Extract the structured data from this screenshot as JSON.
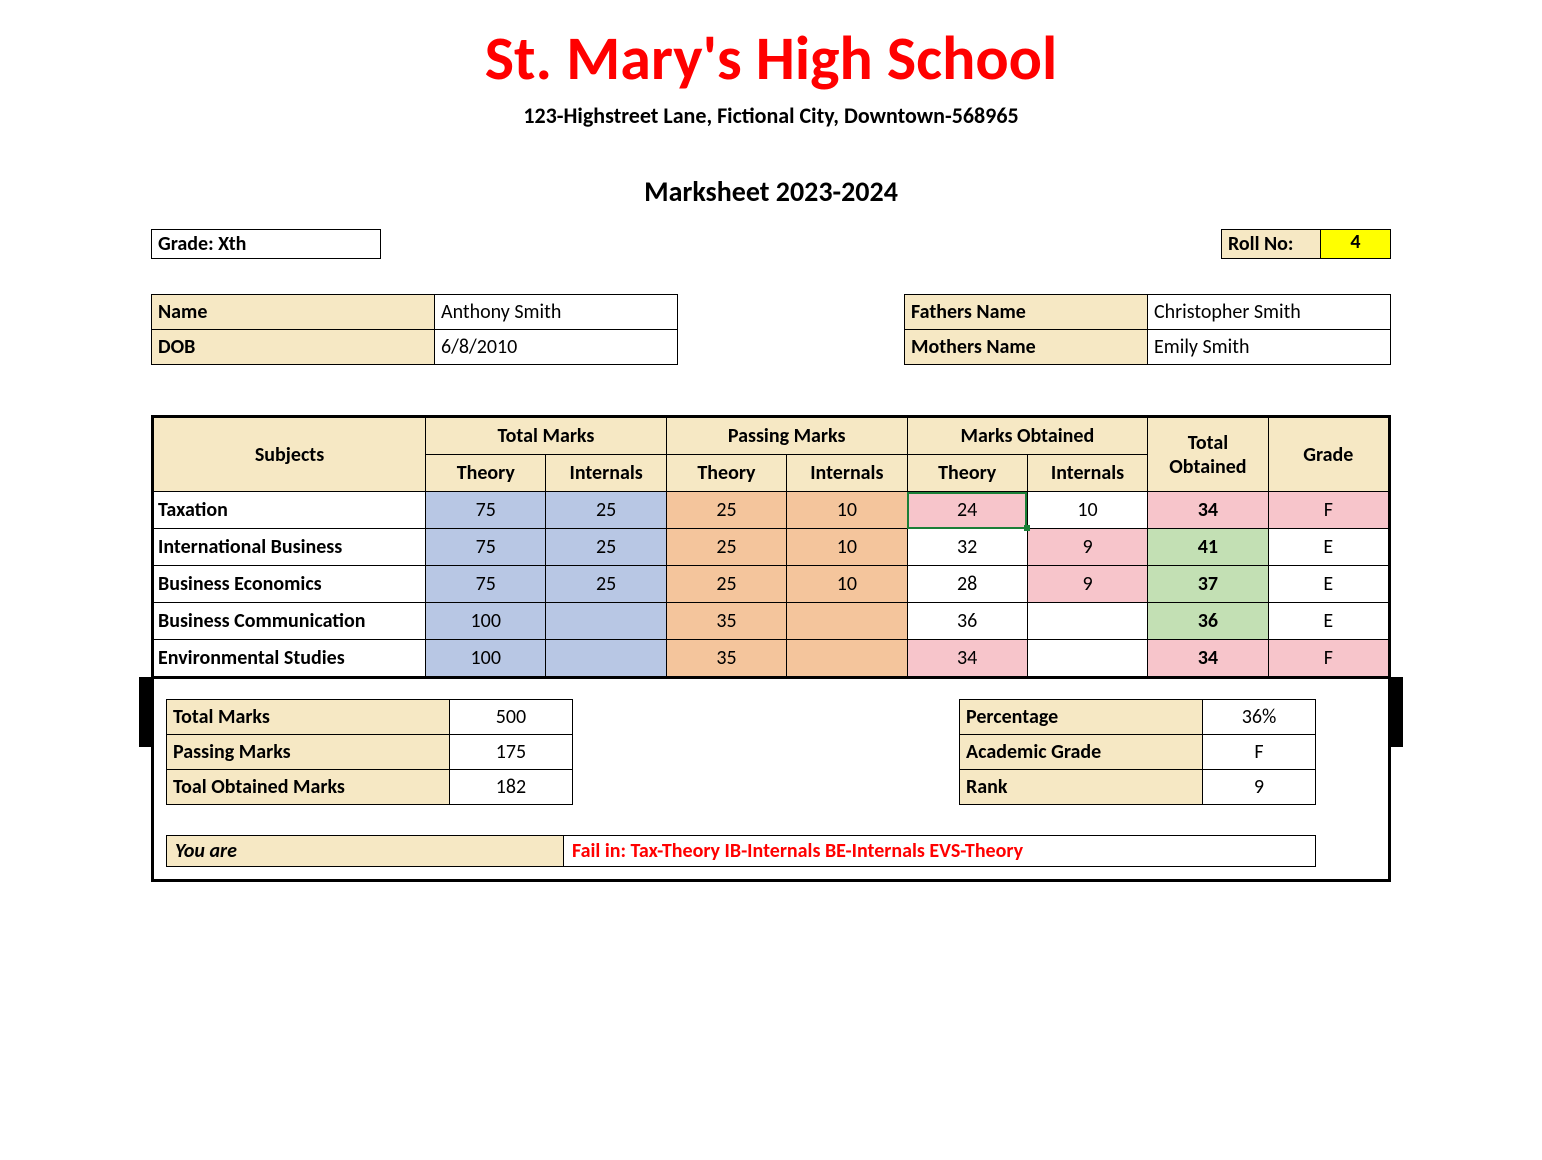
{
  "header": {
    "school_name": "St. Mary's High School",
    "address": "123-Highstreet Lane, Fictional City, Downtown-568965",
    "title": "Marksheet 2023-2024"
  },
  "grade": "Grade: Xth",
  "roll_label": "Roll No:",
  "roll_value": "4",
  "student": {
    "name_label": "Name",
    "name_value": "Anthony Smith",
    "dob_label": "DOB",
    "dob_value": "6/8/2010",
    "father_label": "Fathers Name",
    "father_value": "Christopher Smith",
    "mother_label": "Mothers Name",
    "mother_value": "Emily Smith"
  },
  "table_headers": {
    "subjects": "Subjects",
    "total_marks": "Total Marks",
    "passing_marks": "Passing Marks",
    "marks_obtained": "Marks Obtained",
    "total_obtained": "Total Obtained",
    "grade": "Grade",
    "theory": "Theory",
    "internals": "Internals"
  },
  "subjects": [
    {
      "name": "Taxation",
      "tm_theory": "75",
      "tm_internals": "25",
      "pm_theory": "25",
      "pm_internals": "10",
      "mo_theory": "24",
      "mo_theory_fail": true,
      "mo_theory_selected": true,
      "mo_internals": "10",
      "mo_internals_fail": false,
      "total": "34",
      "total_pass": false,
      "grade": "F",
      "grade_fail": true
    },
    {
      "name": "International Business",
      "tm_theory": "75",
      "tm_internals": "25",
      "pm_theory": "25",
      "pm_internals": "10",
      "mo_theory": "32",
      "mo_theory_fail": false,
      "mo_internals": "9",
      "mo_internals_fail": true,
      "total": "41",
      "total_pass": true,
      "grade": "E",
      "grade_fail": false
    },
    {
      "name": "Business Economics",
      "tm_theory": "75",
      "tm_internals": "25",
      "pm_theory": "25",
      "pm_internals": "10",
      "mo_theory": "28",
      "mo_theory_fail": false,
      "mo_internals": "9",
      "mo_internals_fail": true,
      "total": "37",
      "total_pass": true,
      "grade": "E",
      "grade_fail": false
    },
    {
      "name": "Business Communication",
      "tm_theory": "100",
      "tm_internals": "",
      "pm_theory": "35",
      "pm_internals": "",
      "mo_theory": "36",
      "mo_theory_fail": false,
      "mo_internals": "",
      "mo_internals_fail": false,
      "total": "36",
      "total_pass": true,
      "grade": "E",
      "grade_fail": false
    },
    {
      "name": "Environmental Studies",
      "tm_theory": "100",
      "tm_internals": "",
      "pm_theory": "35",
      "pm_internals": "",
      "mo_theory": "34",
      "mo_theory_fail": true,
      "mo_internals": "",
      "mo_internals_fail": false,
      "total": "34",
      "total_pass": false,
      "grade": "F",
      "grade_fail": true
    }
  ],
  "summary_left": {
    "total_marks_label": "Total Marks",
    "total_marks_value": "500",
    "passing_marks_label": "Passing Marks",
    "passing_marks_value": "175",
    "obtained_label": "Toal Obtained Marks",
    "obtained_value": "182"
  },
  "summary_right": {
    "percentage_label": "Percentage",
    "percentage_value": "36%",
    "academic_label": "Academic  Grade",
    "academic_value": "F",
    "rank_label": "Rank",
    "rank_value": "9"
  },
  "status": {
    "label": "You are",
    "value": "Fail in: Tax-Theory   IB-Internals  BE-Internals  EVS-Theory"
  }
}
